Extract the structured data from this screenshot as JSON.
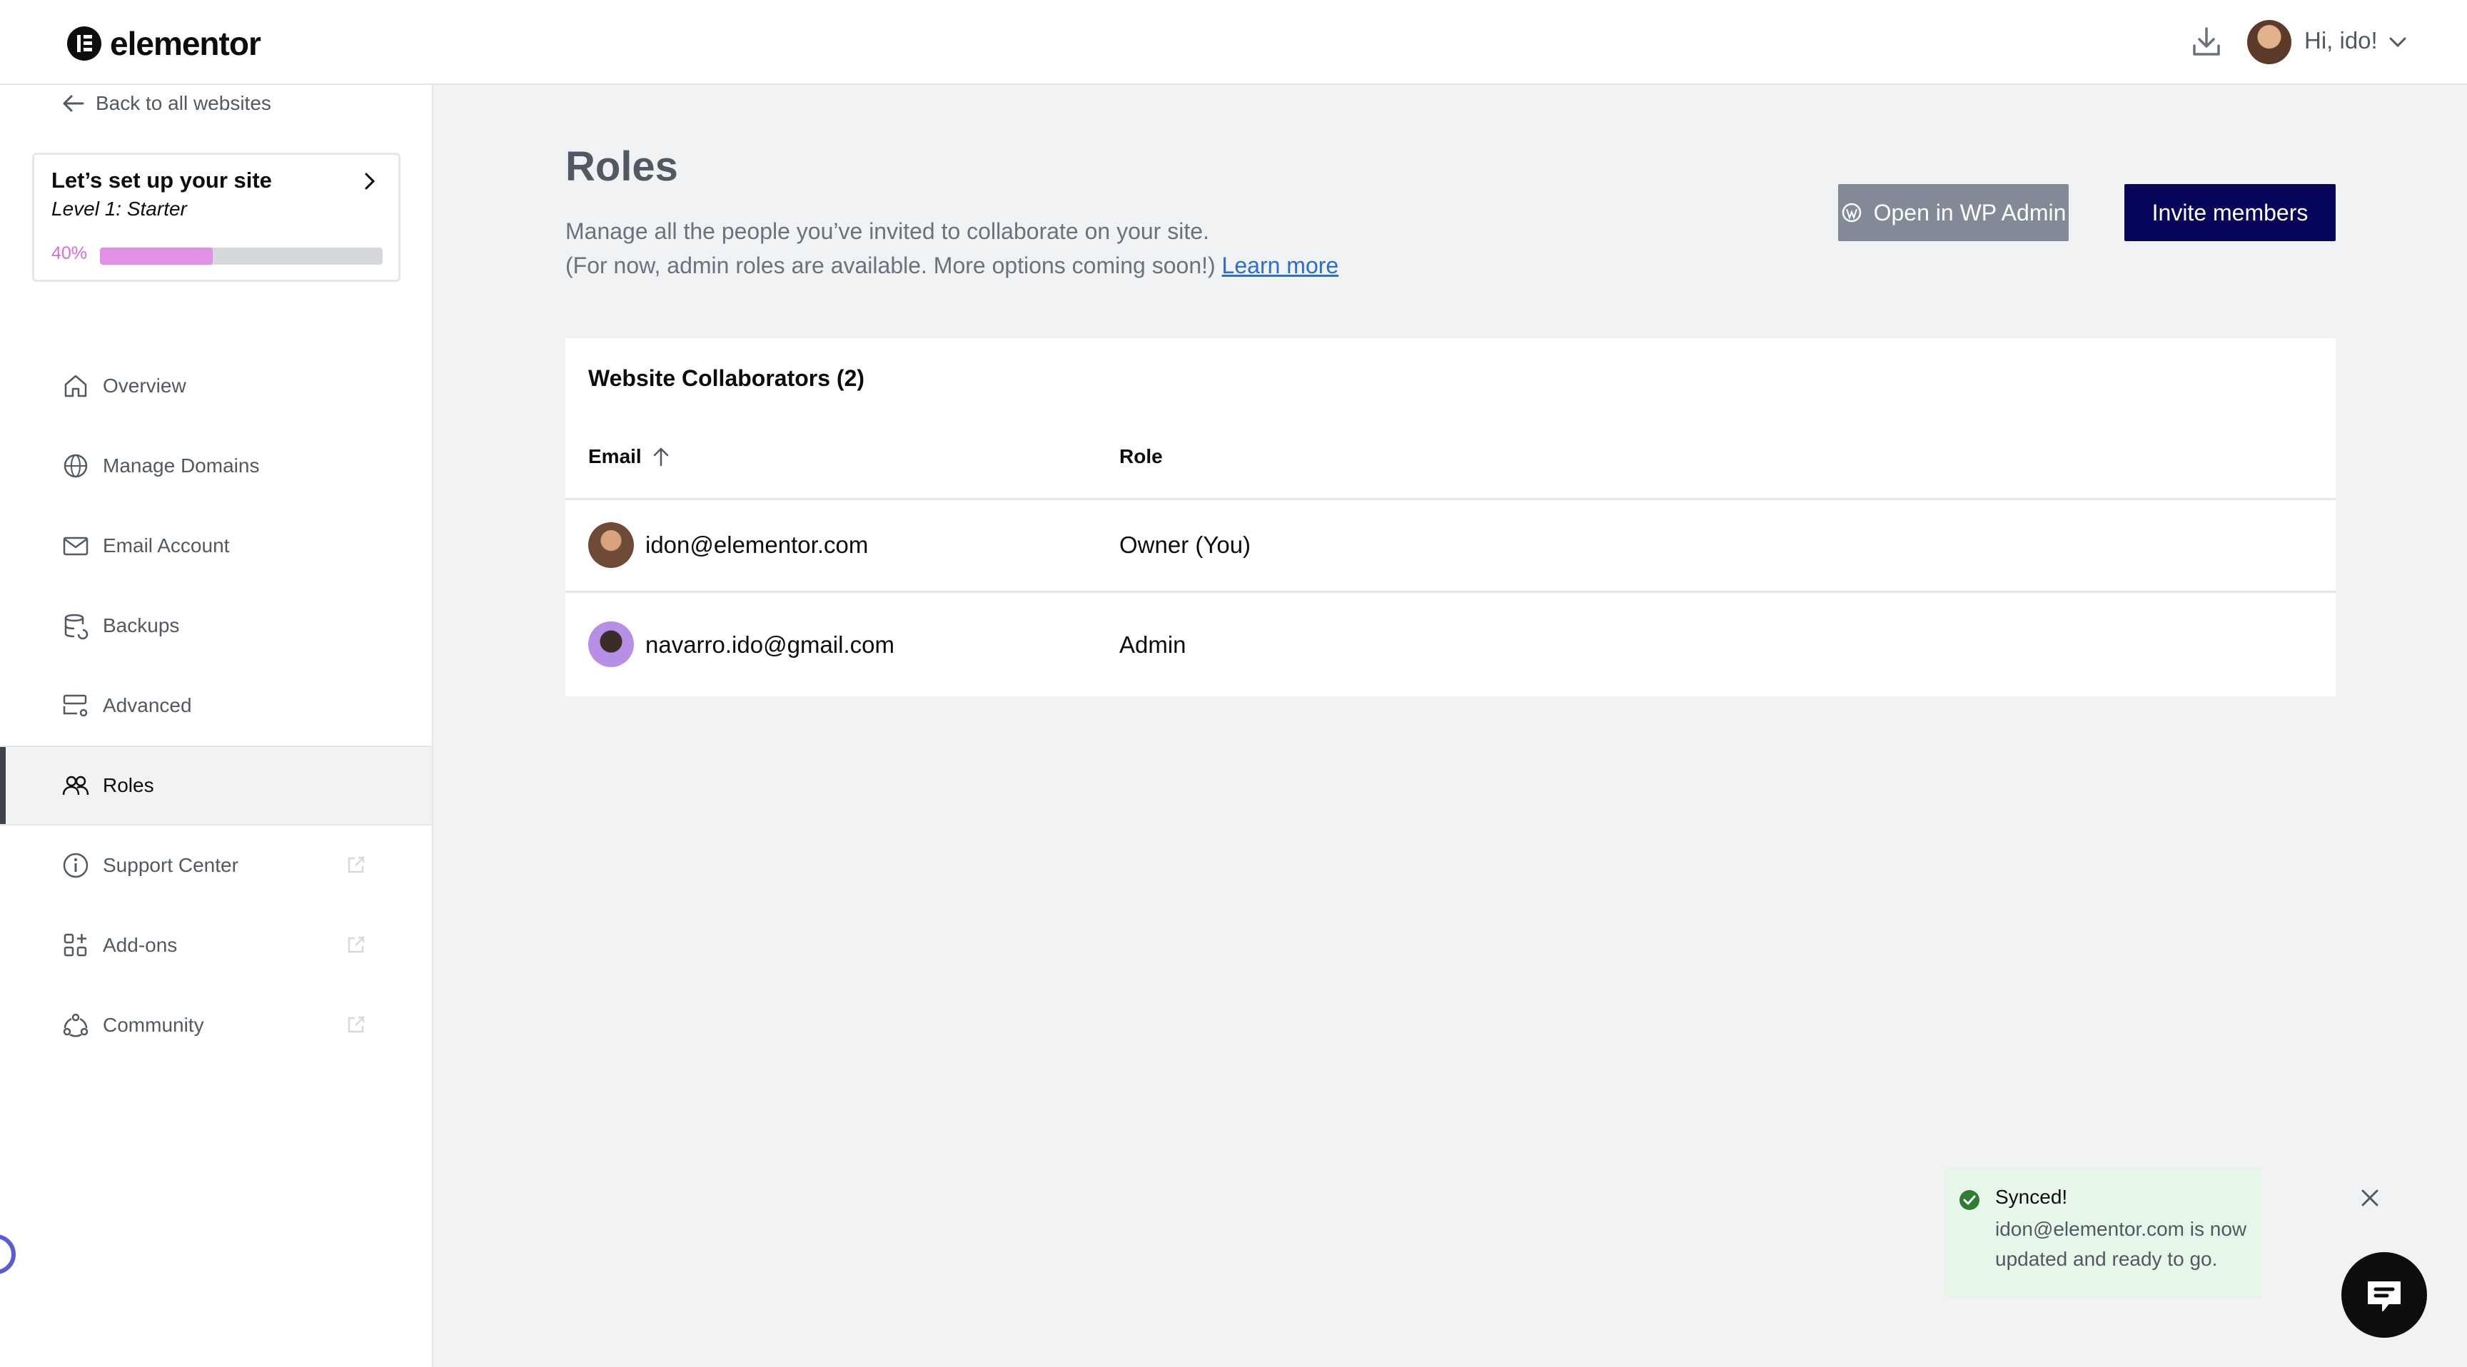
{
  "header": {
    "brand": "elementor",
    "greeting": "Hi, ido!",
    "icons": [
      "download-icon",
      "avatar",
      "chevron-down-icon"
    ]
  },
  "sidebar": {
    "back_label": "Back to all websites",
    "setup": {
      "title": "Let’s set up your site",
      "level": "Level 1: Starter",
      "percent_label": "40%",
      "progress": 0.4
    },
    "items": [
      {
        "label": "Overview",
        "icon": "home-icon"
      },
      {
        "label": "Manage Domains",
        "icon": "globe-icon"
      },
      {
        "label": "Email Account",
        "icon": "envelope-icon"
      },
      {
        "label": "Backups",
        "icon": "database-icon"
      },
      {
        "label": "Advanced",
        "icon": "server-settings-icon"
      },
      {
        "label": "Roles",
        "icon": "users-icon",
        "active": true
      },
      {
        "label": "Support Center",
        "icon": "info-icon",
        "external": true
      },
      {
        "label": "Add-ons",
        "icon": "addons-icon",
        "external": true
      },
      {
        "label": "Community",
        "icon": "community-icon",
        "external": true
      }
    ]
  },
  "main": {
    "title": "Roles",
    "desc_line1": "Manage all the people you’ve invited to collaborate on your site.",
    "desc_line2": "(For now, admin roles are available. More options coming soon!)",
    "learn_more": "Learn more",
    "btn_wp_admin": "Open in WP Admin",
    "btn_invite": "Invite members",
    "table": {
      "title": "Website Collaborators (2)",
      "headers": {
        "email": "Email",
        "role": "Role"
      },
      "rows": [
        {
          "email": "idon@elementor.com",
          "role": "Owner (You)"
        },
        {
          "email": "navarro.ido@gmail.com",
          "role": "Admin"
        }
      ]
    }
  },
  "toast": {
    "title": "Synced!",
    "message": "idon@elementor.com is now updated and ready to go."
  },
  "colors": {
    "accent_dark": "#07065a",
    "wp_button": "#818a96",
    "progress_fill": "#e28fe6",
    "toast_bg": "#e8f5e9",
    "success": "#2e7d32"
  }
}
